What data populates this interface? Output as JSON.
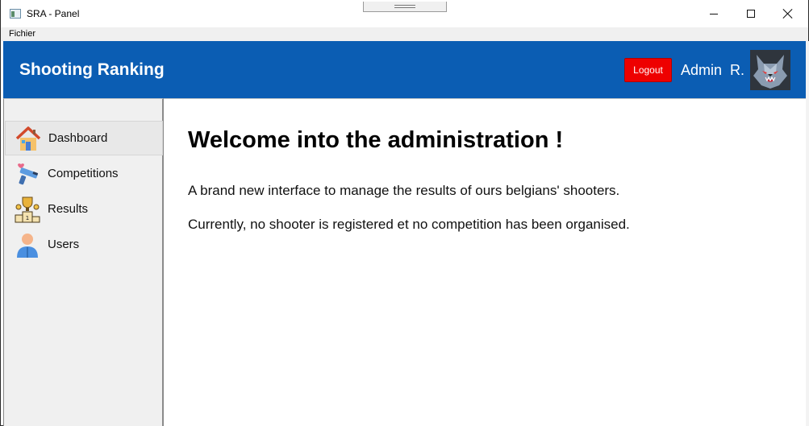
{
  "window": {
    "title": "SRA - Panel"
  },
  "menubar": {
    "items": [
      "Fichier"
    ]
  },
  "header": {
    "brand": "Shooting Ranking",
    "logout_label": "Logout",
    "user_name": "Admin  R.",
    "avatar_icon": "wolf-avatar",
    "background_color": "#0b5db3",
    "logout_color": "#ee0000"
  },
  "sidebar": {
    "items": [
      {
        "label": "Dashboard",
        "icon": "house-icon",
        "active": true
      },
      {
        "label": "Competitions",
        "icon": "gun-icon",
        "active": false
      },
      {
        "label": "Results",
        "icon": "trophy-podium-icon",
        "active": false
      },
      {
        "label": "Users",
        "icon": "user-icon",
        "active": false
      }
    ]
  },
  "main": {
    "title": "Welcome into the administration !",
    "paragraphs": [
      "A brand new interface to manage the results of ours belgians' shooters.",
      "Currently, no shooter is registered et no competition has been organised."
    ]
  }
}
